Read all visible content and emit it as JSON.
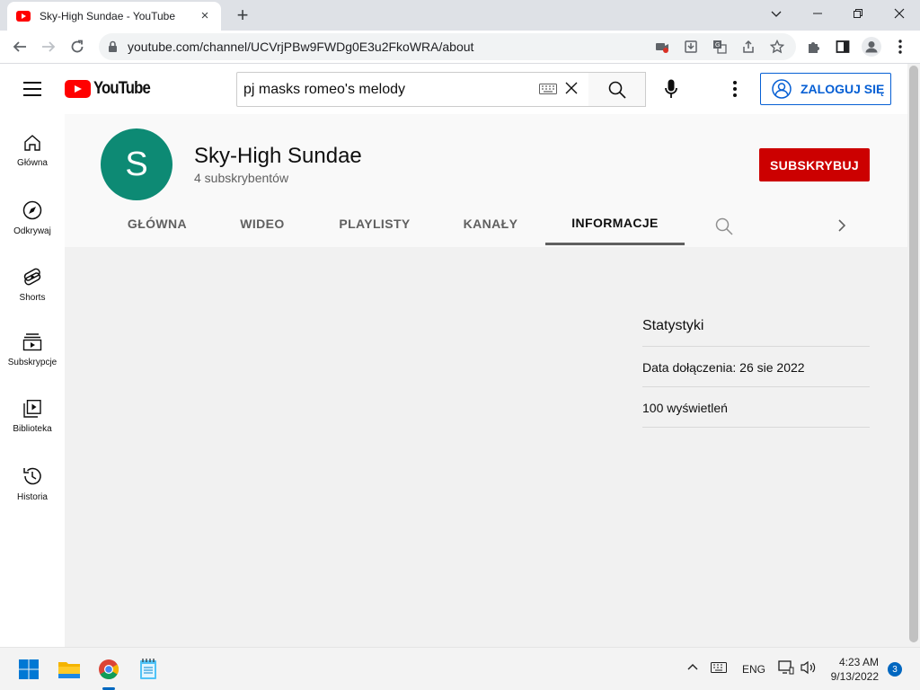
{
  "browser": {
    "tab_title": "Sky-High Sundae - YouTube",
    "url": "youtube.com/channel/UCVrjPBw9FWDg0E3u2FkoWRA/about"
  },
  "masthead": {
    "logo_text": "YouTube",
    "search_value": "pj masks romeo's melody",
    "signin_label": "ZALOGUJ SIĘ"
  },
  "guide": {
    "items": [
      {
        "label": "Główna",
        "icon": "home-icon"
      },
      {
        "label": "Odkrywaj",
        "icon": "compass-icon"
      },
      {
        "label": "Shorts",
        "icon": "shorts-icon"
      },
      {
        "label": "Subskrypcje",
        "icon": "subscriptions-icon"
      },
      {
        "label": "Biblioteka",
        "icon": "library-icon"
      },
      {
        "label": "Historia",
        "icon": "history-icon"
      }
    ]
  },
  "channel": {
    "avatar_letter": "S",
    "avatar_color": "#0d8a74",
    "name": "Sky-High Sundae",
    "subscribers": "4 subskrybentów",
    "subscribe_label": "SUBSKRYBUJ",
    "tabs": [
      "GŁÓWNA",
      "WIDEO",
      "PLAYLISTY",
      "KANAŁY",
      "INFORMACJE"
    ],
    "active_tab": "INFORMACJE"
  },
  "about": {
    "stats_title": "Statystyki",
    "joined": "Data dołączenia: 26 sie 2022",
    "views": "100 wyświetleń"
  },
  "taskbar": {
    "language": "ENG",
    "time": "4:23 AM",
    "date": "9/13/2022",
    "notifications": "3"
  },
  "colors": {
    "youtube_red": "#ff0000",
    "subscribe_red": "#cc0000",
    "signin_blue": "#065fd4"
  }
}
